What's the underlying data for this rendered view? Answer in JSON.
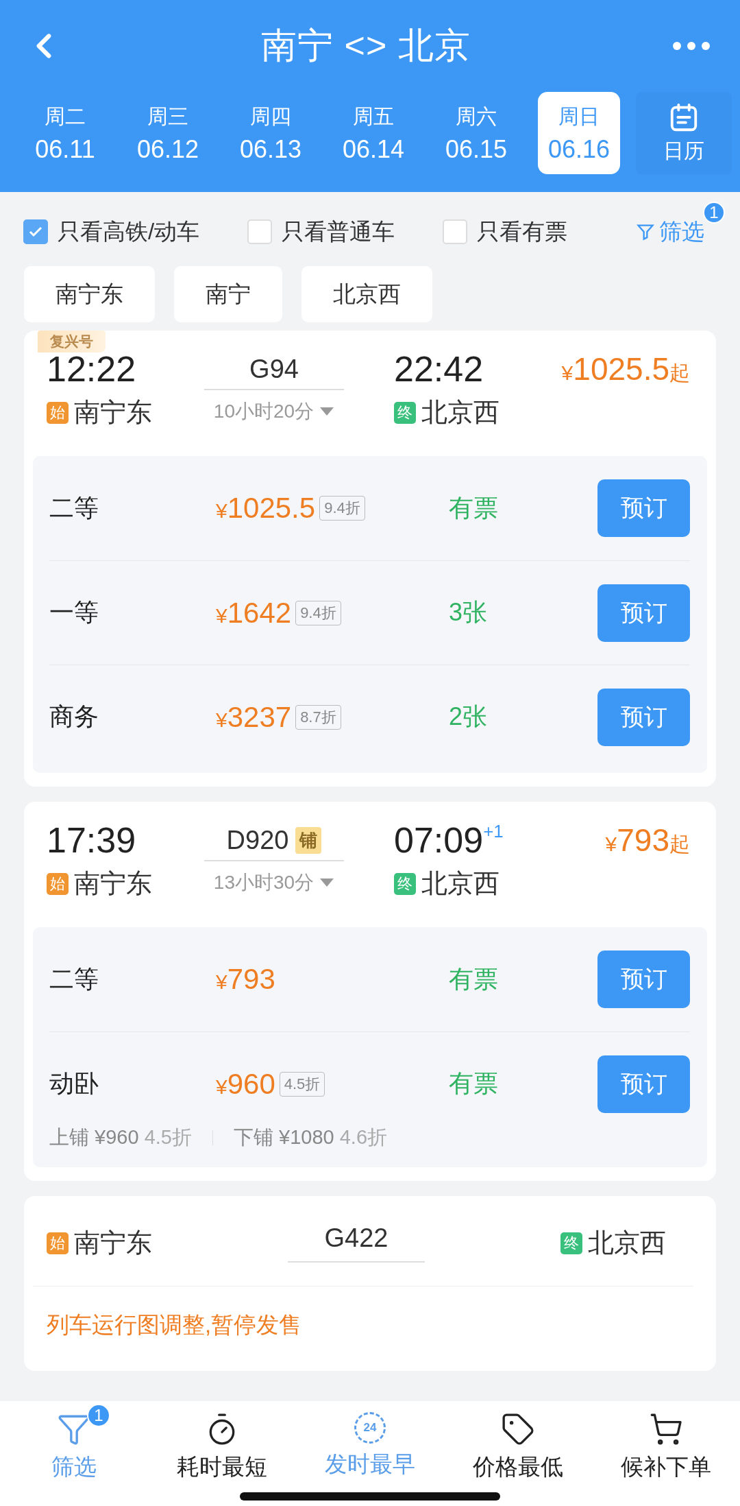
{
  "header": {
    "title": "南宁 <> 北京",
    "calendar_label": "日历"
  },
  "dates": [
    {
      "weekday": "周二",
      "date": "06.11",
      "selected": false
    },
    {
      "weekday": "周三",
      "date": "06.12",
      "selected": false
    },
    {
      "weekday": "周四",
      "date": "06.13",
      "selected": false
    },
    {
      "weekday": "周五",
      "date": "06.14",
      "selected": false
    },
    {
      "weekday": "周六",
      "date": "06.15",
      "selected": false
    },
    {
      "weekday": "周日",
      "date": "06.16",
      "selected": true
    }
  ],
  "filters": [
    {
      "label": "只看高铁/动车",
      "checked": true
    },
    {
      "label": "只看普通车",
      "checked": false
    },
    {
      "label": "只看有票",
      "checked": false
    }
  ],
  "filter_button": {
    "label": "筛选",
    "badge": "1"
  },
  "stations": [
    "南宁东",
    "南宁",
    "北京西"
  ],
  "trains": [
    {
      "kind": "bookable",
      "tag": "复兴号",
      "depart_time": "12:22",
      "number": "G94",
      "arrive_time": "22:42",
      "currency": "¥",
      "price": "1025.5",
      "price_suffix": "起",
      "depart_mark": "始",
      "depart_station": "南宁东",
      "duration": "10小时20分",
      "arrive_mark": "终",
      "arrive_station": "北京西",
      "seats": [
        {
          "class": "二等",
          "currency": "¥",
          "price": "1025.5",
          "discount": "9.4折",
          "availability": "有票",
          "button": "预订"
        },
        {
          "class": "一等",
          "currency": "¥",
          "price": "1642",
          "discount": "9.4折",
          "availability": "3张",
          "button": "预订"
        },
        {
          "class": "商务",
          "currency": "¥",
          "price": "3237",
          "discount": "8.7折",
          "availability": "2张",
          "button": "预订"
        }
      ]
    },
    {
      "kind": "bookable",
      "depart_time": "17:39",
      "number": "D920",
      "number_badge": "铺",
      "arrive_time": "07:09",
      "day_offset": "+1",
      "currency": "¥",
      "price": "793",
      "price_suffix": "起",
      "depart_mark": "始",
      "depart_station": "南宁东",
      "duration": "13小时30分",
      "arrive_mark": "终",
      "arrive_station": "北京西",
      "seats": [
        {
          "class": "二等",
          "currency": "¥",
          "price": "793",
          "availability": "有票",
          "button": "预订"
        },
        {
          "class": "动卧",
          "currency": "¥",
          "price": "960",
          "discount": "4.5折",
          "availability": "有票",
          "button": "预订"
        }
      ],
      "berths": [
        {
          "label": "上铺 ¥960",
          "discount": "4.5折"
        },
        {
          "label": "下铺 ¥1080",
          "discount": "4.6折"
        }
      ]
    },
    {
      "kind": "suspended",
      "depart_mark": "始",
      "depart_station": "南宁东",
      "number": "G422",
      "arrive_mark": "终",
      "arrive_station": "北京西",
      "notice": "列车运行图调整,暂停发售"
    }
  ],
  "bottom_nav": [
    {
      "kind": "filter",
      "label": "筛选",
      "selected": true,
      "badge": "1"
    },
    {
      "kind": "timer",
      "label": "耗时最短",
      "selected": false
    },
    {
      "kind": "clock24",
      "label": "发时最早",
      "selected": true,
      "icon_text": "24"
    },
    {
      "kind": "tag",
      "label": "价格最低",
      "selected": false
    },
    {
      "kind": "cart",
      "label": "候补下单",
      "selected": false
    }
  ]
}
